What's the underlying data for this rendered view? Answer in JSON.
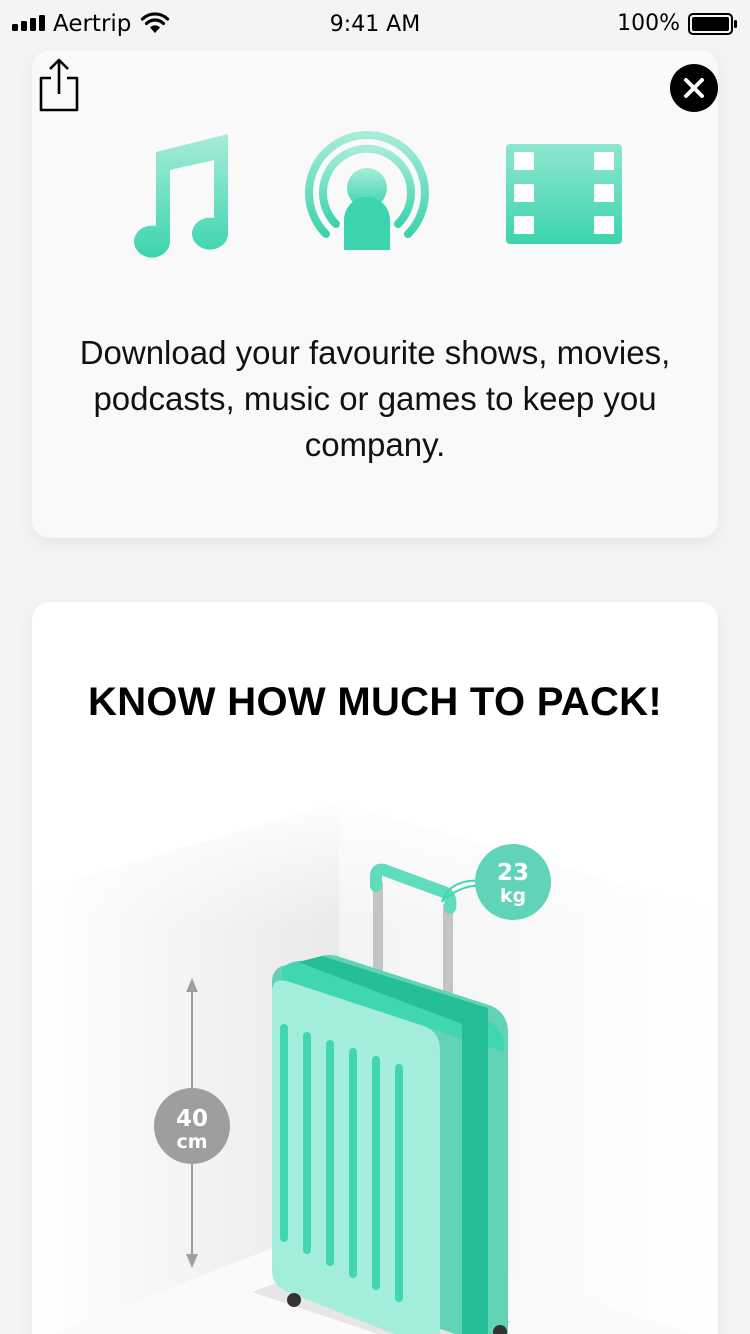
{
  "status_bar": {
    "carrier": "Aertrip",
    "time": "9:41 AM",
    "battery_percent": "100%"
  },
  "controls": {
    "share_icon": "share-icon",
    "close_icon": "close-icon"
  },
  "entertainment_card": {
    "icons": [
      "music-note-icon",
      "podcast-icon",
      "film-strip-icon"
    ],
    "text": "Download your favourite shows, movies, podcasts, music or games to keep you company."
  },
  "packing_card": {
    "title": "KNOW HOW MUCH TO PACK!",
    "height_value": "40",
    "height_unit": "cm",
    "weight_value": "23",
    "weight_unit": "kg"
  },
  "colors": {
    "accent": "#3fd6b0",
    "accent_light": "#a2eedb",
    "accent_dark": "#1fbf98",
    "badge_gray": "#9e9e9e"
  }
}
